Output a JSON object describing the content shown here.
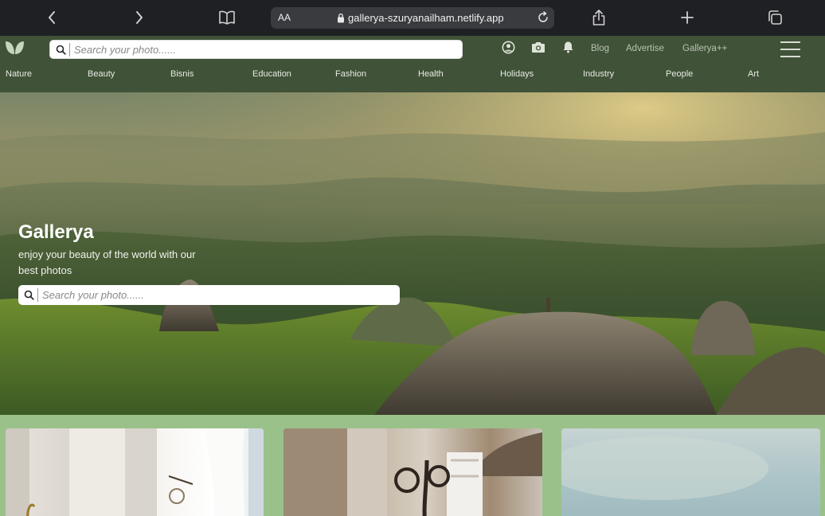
{
  "browser": {
    "text_size_label": "AA",
    "url": "gallerya-szuryanailham.netlify.app"
  },
  "nav": {
    "search_placeholder": "Search your photo......",
    "links": [
      "Blog",
      "Advertise",
      "Gallerya++"
    ],
    "categories": [
      "Nature",
      "Beauty",
      "Bisnis",
      "Education",
      "Fashion",
      "Health",
      "Holidays",
      "Industry",
      "People",
      "Art"
    ]
  },
  "hero": {
    "title": "Gallerya",
    "subtitle": "enjoy your beauty of the world with our best photos",
    "search_placeholder": "Search your photo......"
  },
  "colors": {
    "browser_bar": "#1f2023",
    "navbar": "#405238",
    "gallery_bg": "#9bc18a"
  },
  "gallery": {
    "cards": [
      "card-1",
      "card-2",
      "card-3"
    ]
  }
}
